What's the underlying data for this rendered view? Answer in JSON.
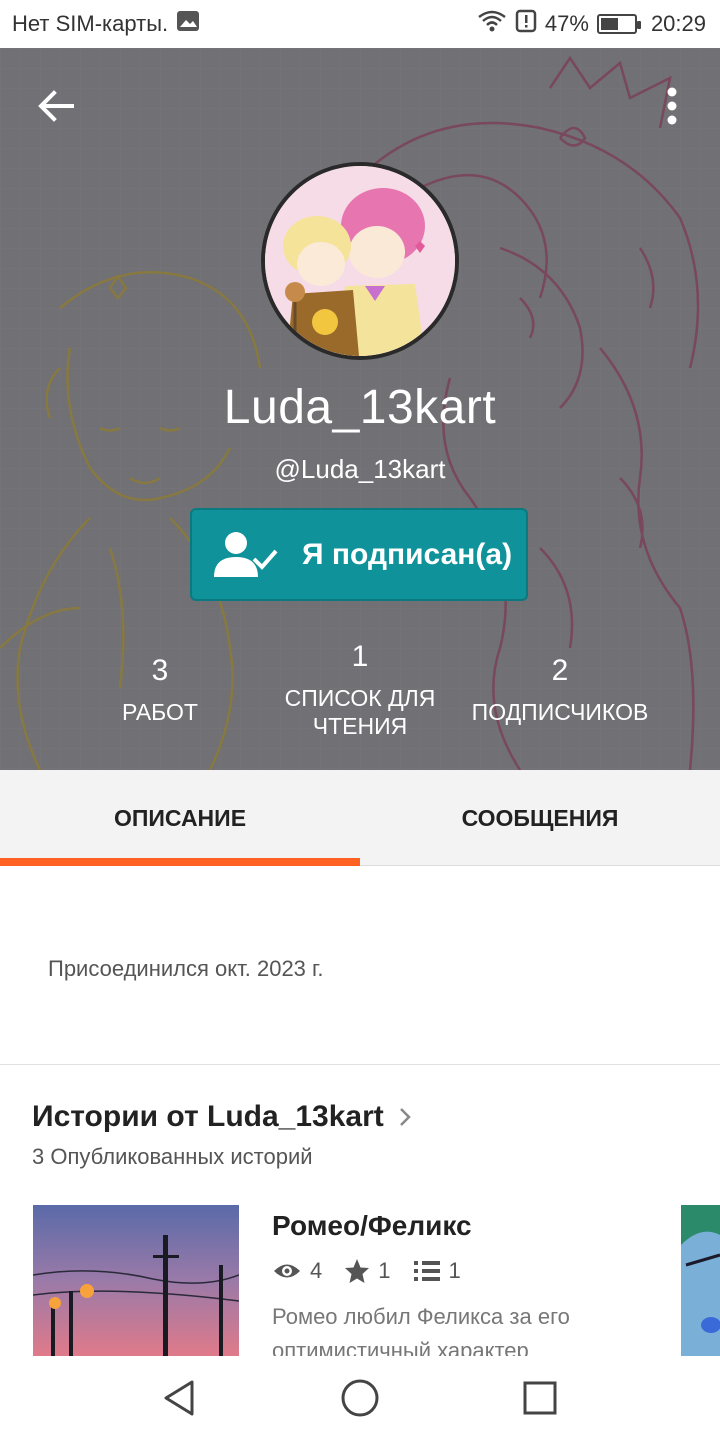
{
  "status_bar": {
    "carrier": "Нет SIM-карты.",
    "battery_percent": "47%",
    "battery_level": 0.47,
    "time": "20:29"
  },
  "profile": {
    "display_name": "Luda_13kart",
    "username": "@Luda_13kart",
    "follow_button_label": "Я подписан(а)",
    "stats": [
      {
        "value": "3",
        "label": "РАБОТ"
      },
      {
        "value": "1",
        "label": "СПИСОК ДЛЯ ЧТЕНИЯ"
      },
      {
        "value": "2",
        "label": "ПОДПИСЧИКОВ"
      }
    ]
  },
  "tabs": [
    {
      "label": "ОПИСАНИЕ",
      "active": true
    },
    {
      "label": "СООБЩЕНИЯ",
      "active": false
    }
  ],
  "about": {
    "joined": "Присоединился окт. 2023 г."
  },
  "stories": {
    "title": "Истории от Luda_13kart",
    "subtitle": "3 Опубликованных историй",
    "items": [
      {
        "title": "Ромео/Феликс",
        "reads": "4",
        "votes": "1",
        "parts": "1",
        "description": "Ромео любил Феликса за его оптимистичный характер"
      }
    ]
  },
  "colors": {
    "accent_orange": "#ff6122",
    "follow_teal": "#0f9299",
    "header_gray": "#707075"
  }
}
